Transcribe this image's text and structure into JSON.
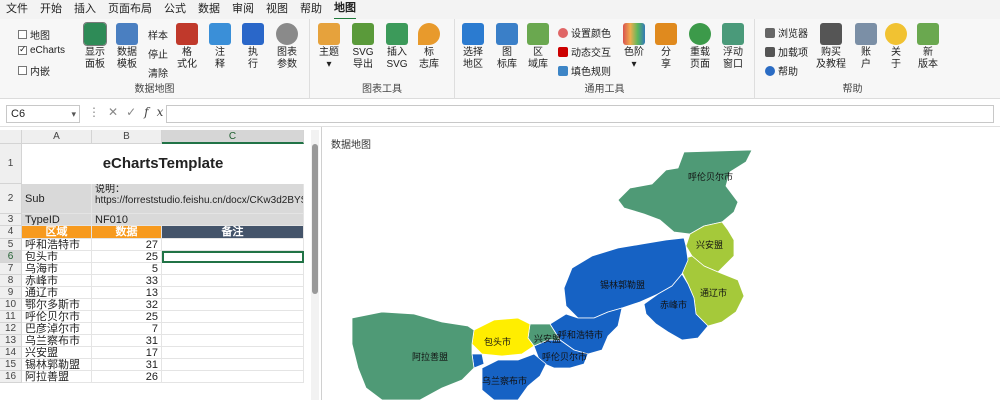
{
  "menu": [
    "文件",
    "开始",
    "插入",
    "页面布局",
    "公式",
    "数据",
    "审阅",
    "视图",
    "帮助",
    "地图"
  ],
  "ribbon": {
    "group1": {
      "title": "数据地图",
      "checks": [
        {
          "label": "地图",
          "checked": false
        },
        {
          "label": "eCharts",
          "checked": true
        },
        {
          "label": "内嵌",
          "checked": false
        }
      ],
      "buttons": [
        {
          "label": "显示\n面板",
          "icon": "show-panel-icon"
        },
        {
          "label": "数据\n模板",
          "icon": "data-template-icon"
        },
        {
          "label": "格\n式化",
          "icon": "format-icon"
        },
        {
          "label": "注\n释",
          "icon": "annotation-icon"
        },
        {
          "label": "执\n行",
          "icon": "run-icon"
        }
      ],
      "small": [
        "样本",
        "停止",
        "清除"
      ]
    },
    "group2": {
      "title": "图表工具",
      "buttons": [
        {
          "label": "图表\n参数",
          "icon": "gear-icon"
        },
        {
          "label": "主题\n▾",
          "icon": "theme-icon"
        },
        {
          "label": "SVG\n导出",
          "icon": "svg-export-icon"
        },
        {
          "label": "插入\nSVG",
          "icon": "insert-svg-icon"
        },
        {
          "label": "标\n志库",
          "icon": "marker-library-icon"
        }
      ]
    },
    "group3": {
      "title": "通用工具",
      "buttons": [
        {
          "label": "选择\n地区",
          "icon": "select-region-icon"
        },
        {
          "label": "图\n标库",
          "icon": "icon-library-icon"
        },
        {
          "label": "区\n域库",
          "icon": "region-library-icon"
        },
        {
          "label": "色阶\n▾",
          "icon": "color-scale-icon"
        },
        {
          "label": "分\n享",
          "icon": "share-icon"
        },
        {
          "label": "重载\n页面",
          "icon": "reload-icon"
        },
        {
          "label": "浮动\n窗口",
          "icon": "float-window-icon"
        }
      ],
      "small": [
        "设置颜色",
        "动态交互",
        "填色规则"
      ]
    },
    "group4": {
      "title": "帮助",
      "small": [
        "浏览器",
        "加载项",
        "帮助"
      ],
      "buttons": [
        {
          "label": "购买\n及教程",
          "icon": "purchase-icon"
        },
        {
          "label": "账\n户",
          "icon": "account-icon"
        },
        {
          "label": "关\n于",
          "icon": "about-icon"
        },
        {
          "label": "新\n版本",
          "icon": "new-version-icon"
        }
      ]
    }
  },
  "formula_bar": {
    "name_box": "C6",
    "fx": "fx",
    "formula": ""
  },
  "sheet": {
    "columns": [
      "A",
      "B",
      "C"
    ],
    "rows": [
      "1",
      "2",
      "3",
      "4",
      "5",
      "6",
      "7",
      "8",
      "9",
      "10",
      "11",
      "12",
      "13",
      "14",
      "15",
      "16"
    ],
    "title": "eChartsTemplate",
    "sub_label": "Sub",
    "sub_note": "说明：https://forreststudio.feishu.cn/docx/CKw3d2BYSoAkrZyOaVccfwuYnOh",
    "typeid_label": "TypeID",
    "typeid_value": "NF010",
    "header": [
      "区域",
      "数据",
      "备注"
    ],
    "data": [
      [
        "呼和浩特市",
        "27"
      ],
      [
        "包头市",
        "25"
      ],
      [
        "乌海市",
        "5"
      ],
      [
        "赤峰市",
        "33"
      ],
      [
        "通辽市",
        "13"
      ],
      [
        "鄂尔多斯市",
        "32"
      ],
      [
        "呼伦贝尔市",
        "25"
      ],
      [
        "巴彦淖尔市",
        "7"
      ],
      [
        "乌兰察布市",
        "31"
      ],
      [
        "兴安盟",
        "17"
      ],
      [
        "锡林郭勒盟",
        "31"
      ],
      [
        "阿拉善盟",
        "26"
      ]
    ]
  },
  "map": {
    "title": "数据地图",
    "colors": {
      "green": "#4f9a76",
      "blue": "#1662c4",
      "lime": "#a5c93a",
      "yellow": "#ffee00"
    },
    "regions": [
      {
        "name": "呼伦贝尔市",
        "color": "green"
      },
      {
        "name": "兴安盟",
        "color": "lime"
      },
      {
        "name": "通辽市",
        "color": "lime"
      },
      {
        "name": "锡林郭勒盟",
        "color": "blue"
      },
      {
        "name": "赤峰市",
        "color": "blue"
      },
      {
        "name": "乌兰察布市",
        "color": "blue"
      },
      {
        "name": "巴彦淖尔市",
        "color": "yellow"
      },
      {
        "name": "包头市",
        "color": "green"
      },
      {
        "name": "呼和浩特市",
        "color": "blue"
      },
      {
        "name": "鄂尔多斯市",
        "color": "blue"
      },
      {
        "name": "乌海市",
        "color": "blue"
      },
      {
        "name": "阿拉善盟",
        "color": "green"
      }
    ]
  }
}
